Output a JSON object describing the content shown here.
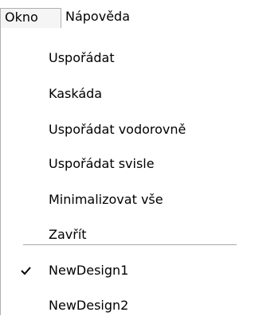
{
  "menubar": {
    "window_label": "Okno",
    "help_label": "Nápověda"
  },
  "window_menu": {
    "items": [
      {
        "label": "Uspořádat"
      },
      {
        "label": "Kaskáda"
      },
      {
        "label": "Uspořádat vodorovně"
      },
      {
        "label": "Uspořádat svisle"
      },
      {
        "label": "Minimalizovat vše"
      },
      {
        "label": "Zavřít"
      }
    ],
    "windows": [
      {
        "label": "NewDesign1",
        "checked": true,
        "icon": "checkmark-icon"
      },
      {
        "label": "NewDesign2",
        "checked": false
      }
    ]
  }
}
